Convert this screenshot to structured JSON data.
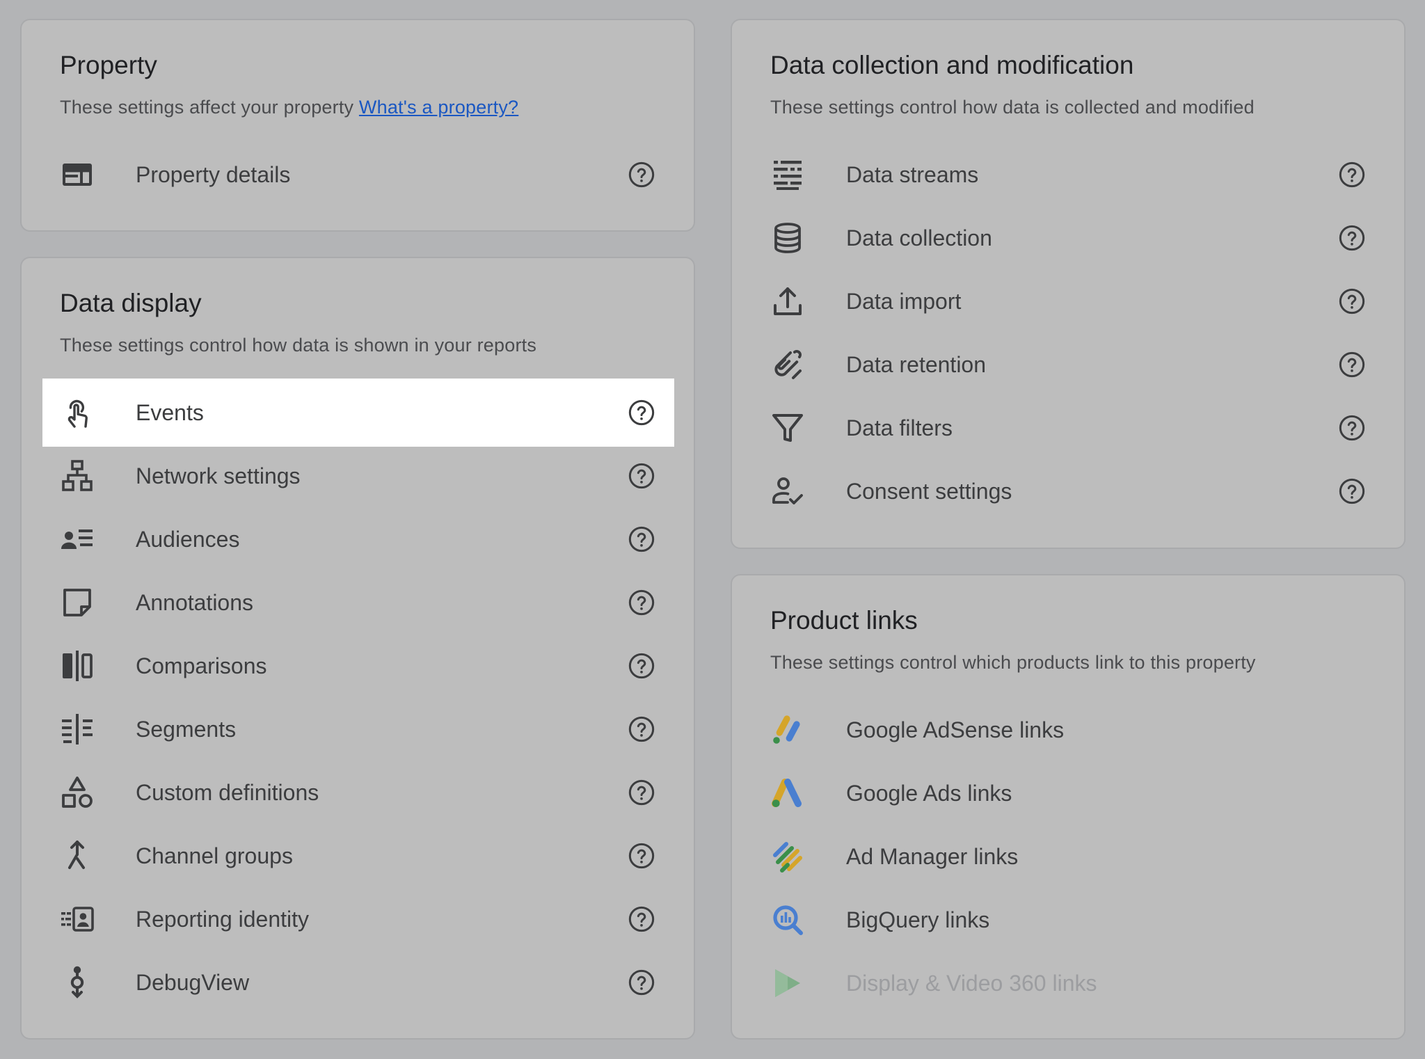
{
  "property": {
    "title": "Property",
    "subtitle": "These settings affect your property",
    "subtitle_link": "What's a property?",
    "items": [
      {
        "label": "Property details",
        "icon": "property-details-icon"
      }
    ]
  },
  "display": {
    "title": "Data display",
    "subtitle": "These settings control how data is shown in your reports",
    "items": [
      {
        "label": "Events",
        "icon": "touch-icon",
        "highlighted": true
      },
      {
        "label": "Network settings",
        "icon": "network-icon"
      },
      {
        "label": "Audiences",
        "icon": "audience-icon"
      },
      {
        "label": "Annotations",
        "icon": "sticky-note-icon"
      },
      {
        "label": "Comparisons",
        "icon": "compare-icon"
      },
      {
        "label": "Segments",
        "icon": "segment-icon"
      },
      {
        "label": "Custom definitions",
        "icon": "shapes-icon"
      },
      {
        "label": "Channel groups",
        "icon": "merge-icon"
      },
      {
        "label": "Reporting identity",
        "icon": "identity-icon"
      },
      {
        "label": "DebugView",
        "icon": "debug-icon"
      }
    ]
  },
  "collection": {
    "title": "Data collection and modification",
    "subtitle": "These settings control how data is collected and modified",
    "items": [
      {
        "label": "Data streams",
        "icon": "streams-icon"
      },
      {
        "label": "Data collection",
        "icon": "database-icon"
      },
      {
        "label": "Data import",
        "icon": "upload-icon"
      },
      {
        "label": "Data retention",
        "icon": "retention-icon"
      },
      {
        "label": "Data filters",
        "icon": "filter-icon"
      },
      {
        "label": "Consent settings",
        "icon": "consent-icon"
      }
    ]
  },
  "links": {
    "title": "Product links",
    "subtitle": "These settings control which products link to this property",
    "items": [
      {
        "label": "Google AdSense links",
        "icon": "adsense-icon"
      },
      {
        "label": "Google Ads links",
        "icon": "google-ads-icon"
      },
      {
        "label": "Ad Manager links",
        "icon": "ad-manager-icon"
      },
      {
        "label": "BigQuery links",
        "icon": "bigquery-icon"
      },
      {
        "label": "Display & Video 360 links",
        "icon": "dv360-icon",
        "disabled": true
      }
    ]
  },
  "colors": {
    "background": "#b3b4b6",
    "card": "#bdbdbd",
    "link": "#1a57c2",
    "highlight": "#ffffff",
    "google_blue": "#4a7fd0",
    "google_yellow": "#d5a52a",
    "google_green": "#3a8f4a"
  }
}
